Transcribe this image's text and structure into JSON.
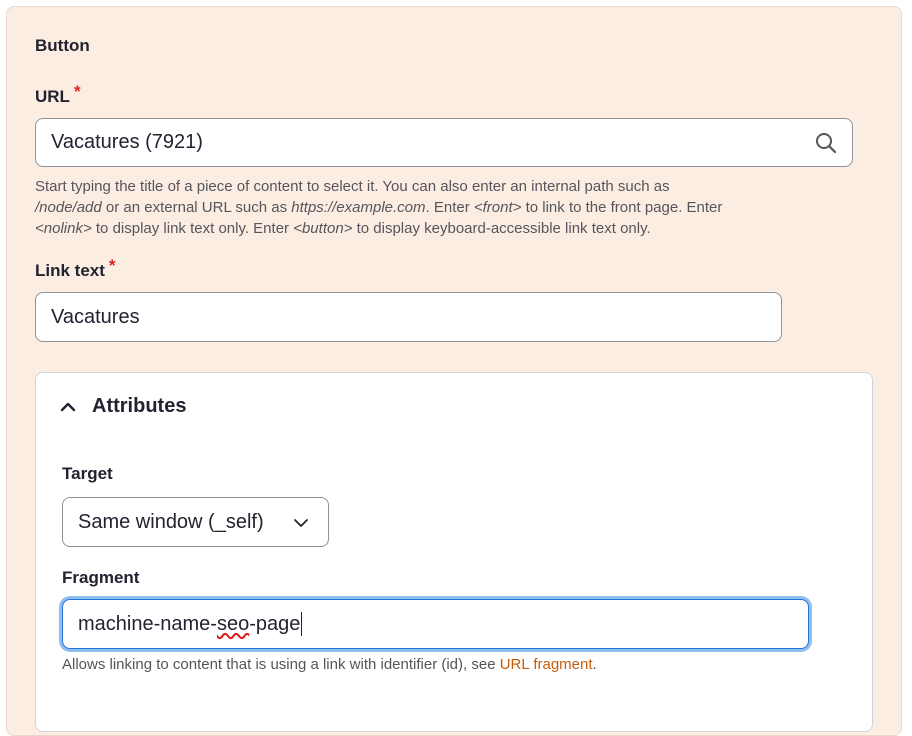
{
  "section": {
    "title": "Button"
  },
  "url_field": {
    "label": "URL",
    "required_mark": "*",
    "value": "Vacatures (7921)",
    "help": {
      "t1": "Start typing the title of a piece of content to select it. You can also enter an internal path such as",
      "e1": "/node/add",
      "t2": " or an external URL such as ",
      "e2": "https://example.com",
      "t3": ". Enter ",
      "e3": "<front>",
      "t4": " to link to the front page. Enter",
      "e4": "<nolink>",
      "t5": " to display link text only. Enter ",
      "e5": "<button>",
      "t6": " to display keyboard-accessible link text only."
    }
  },
  "link_text_field": {
    "label": "Link text",
    "required_mark": "*",
    "value": "Vacatures"
  },
  "attributes": {
    "summary": "Attributes",
    "expanded": true,
    "target": {
      "label": "Target",
      "selected": "Same window (_self)"
    },
    "fragment": {
      "label": "Fragment",
      "value_pre": "machine-name-",
      "value_misspelled": "seo",
      "value_post": "-page",
      "help_text": "Allows linking to content that is using a link with identifier (id), see ",
      "help_link": "URL fragment",
      "help_end": "."
    }
  },
  "colors": {
    "panel_bg": "#fcede3",
    "required": "#dc2323",
    "link": "#c75b0a",
    "focus": "#2871d6"
  },
  "icons": {
    "search": "search-icon",
    "collapse": "chevron-up-icon",
    "dropdown": "chevron-down-icon"
  }
}
